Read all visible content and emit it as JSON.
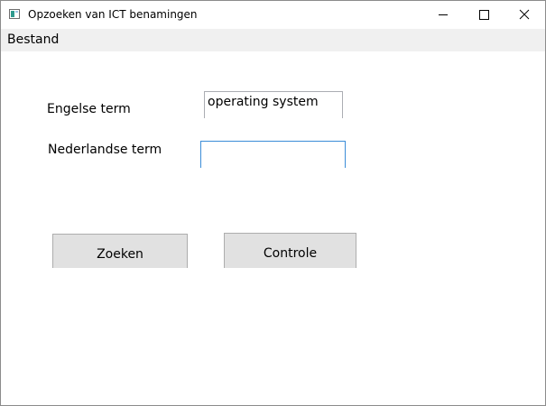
{
  "window": {
    "title": "Opzoeken van ICT benamingen"
  },
  "menu": {
    "items": [
      "Bestand"
    ]
  },
  "form": {
    "english_label": "Engelse term",
    "english_value": "operating system",
    "dutch_label": "Nederlandse term",
    "dutch_value": ""
  },
  "buttons": {
    "search_label": "Zoeken",
    "check_label": "Controle"
  },
  "colors": {
    "focus_border": "#3b8dd8",
    "button_face": "#e1e1e1",
    "menubar_bg": "#f0f0f0"
  }
}
